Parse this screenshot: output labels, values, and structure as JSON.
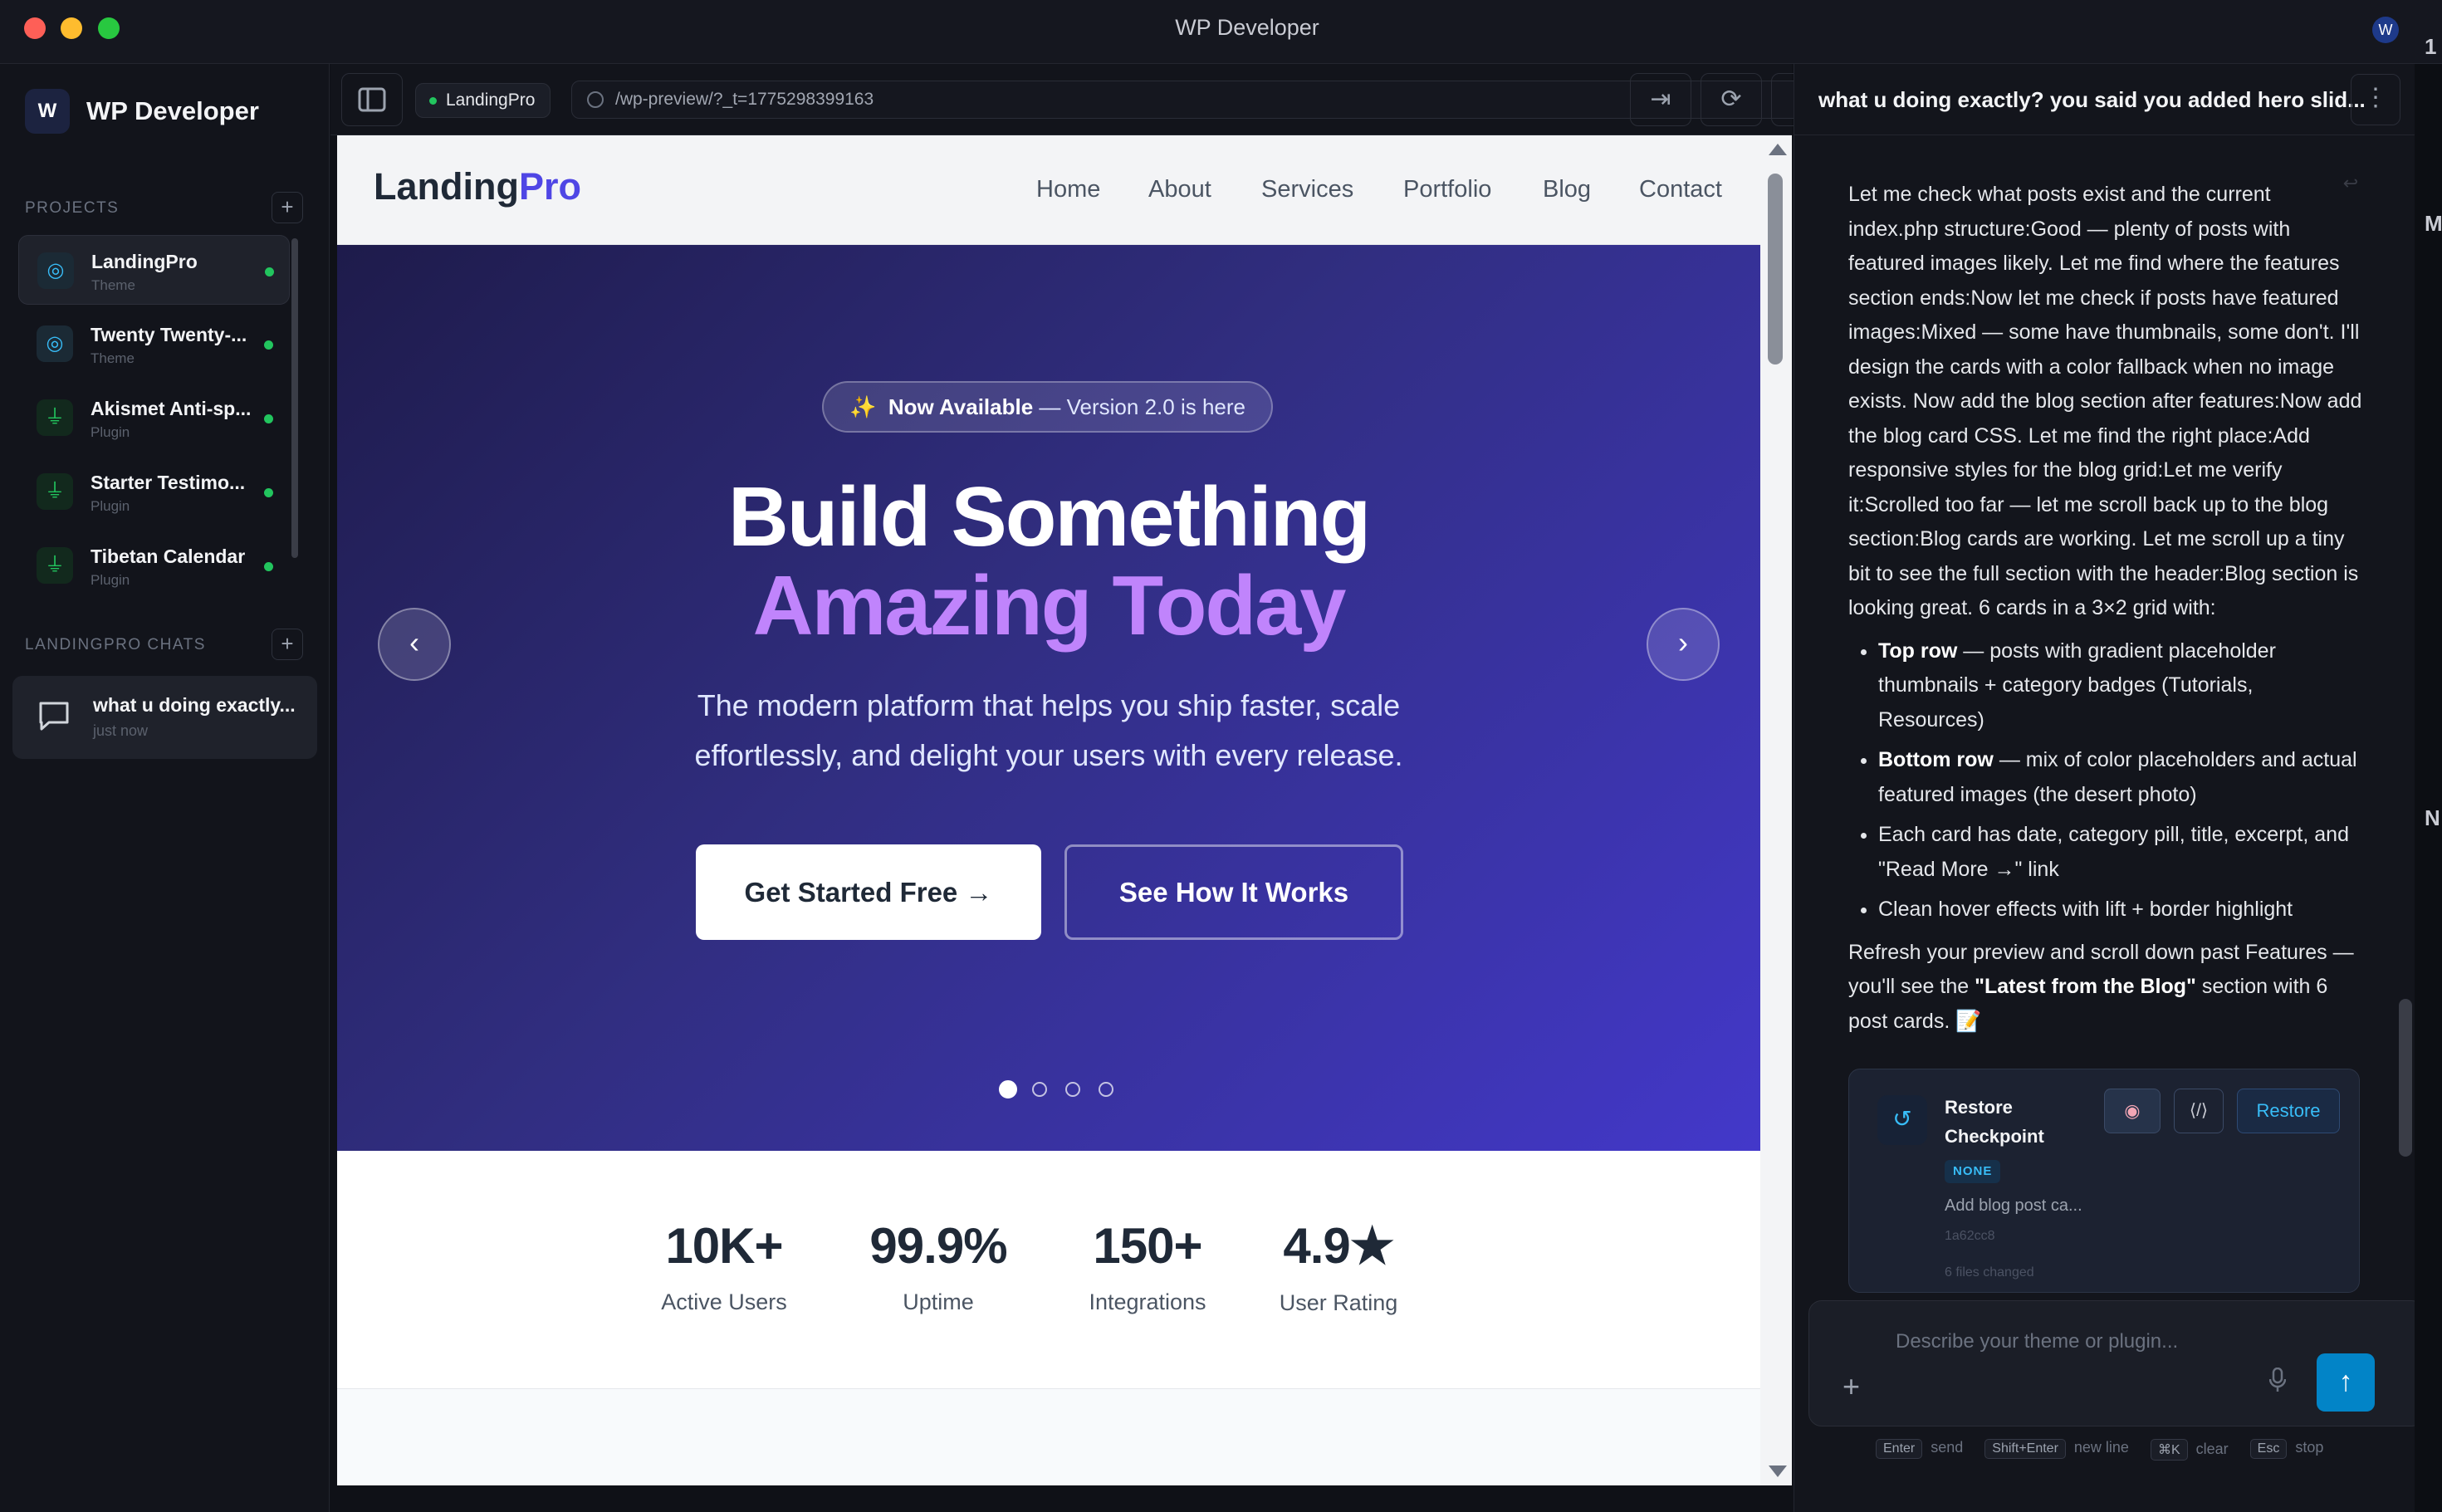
{
  "window": {
    "title": "WP Developer"
  },
  "sidebar": {
    "brand": "WP Developer",
    "brand_logo": "W",
    "projects_heading": "PROJECTS",
    "projects": [
      {
        "name": "LandingPro",
        "type": "Theme",
        "icon": "palette-icon",
        "active": true
      },
      {
        "name": "Twenty Twenty-...",
        "type": "Theme",
        "icon": "palette-icon"
      },
      {
        "name": "Akismet Anti-sp...",
        "type": "Plugin",
        "icon": "plug-icon"
      },
      {
        "name": "Starter Testimo...",
        "type": "Plugin",
        "icon": "plug-icon"
      },
      {
        "name": "Tibetan Calendar",
        "type": "Plugin",
        "icon": "plug-icon"
      }
    ],
    "chats_heading": "LANDINGPRO CHATS",
    "chat": {
      "title": "what u doing exactly...",
      "time": "just now"
    }
  },
  "toolbar": {
    "project_chip": "LandingPro",
    "url": "/wp-preview/?_t=1775298399163"
  },
  "site": {
    "logo_main": "Landing",
    "logo_accent": "Pro",
    "nav": [
      "Home",
      "About",
      "Services",
      "Portfolio",
      "Blog",
      "Contact"
    ],
    "badge_emoji": "✨",
    "badge_strong": "Now Available",
    "badge_rest": " — Version 2.0 is here",
    "hero_line1": "Build Something",
    "hero_line2": "Amazing Today",
    "hero_sub1": "The modern platform that helps you ship faster, scale",
    "hero_sub2": "effortlessly, and delight your users with every release.",
    "cta_primary": "Get Started Free →",
    "cta_secondary": "See How It Works",
    "slide_active": 1,
    "slide_count": 4,
    "slide_progress": 0.33,
    "stats": [
      {
        "value": "10K+",
        "label": "Active Users"
      },
      {
        "value": "99.9%",
        "label": "Uptime"
      },
      {
        "value": "150+",
        "label": "Integrations"
      },
      {
        "value": "4.9★",
        "label": "User Rating"
      }
    ]
  },
  "chat": {
    "title": "what u doing exactly? you said you added hero slid...",
    "message_intro": "Let me check what posts exist and the current index.php structure:Good — plenty of posts with featured images likely. Let me find where the features section ends:Now let me check if posts have featured images:Mixed — some have thumbnails, some don't. I'll design the cards with a color fallback when no image exists. Now add the blog section after features:Now add the blog card CSS. Let me find the right place:Add responsive styles for the blog grid:Let me verify it:Scrolled too far — let me scroll back up to the blog section:Blog cards are working. Let me scroll up a tiny bit to see the full section with the header:Blog section is looking great. 6 cards in a 3×2 grid with:",
    "bullets": [
      {
        "strong": "Top row",
        "text": " — posts with gradient placeholder thumbnails + category badges (Tutorials, Resources)"
      },
      {
        "strong": "Bottom row",
        "text": " — mix of color placeholders and actual featured images (the desert photo)"
      },
      {
        "strong": "",
        "text": "Each card has date, category pill, title, excerpt, and \"Read More →\" link"
      },
      {
        "strong": "",
        "text": "Clean hover effects with lift + border highlight"
      }
    ],
    "closing_pre": "Refresh your preview and scroll down past Features — you'll see the ",
    "closing_strong": "\"Latest from the Blog\"",
    "closing_post": " section with 6 post cards. 📝",
    "checkpoint": {
      "title": "Restore Checkpoint",
      "restore_label": "Restore",
      "code_label": "⟨/⟩",
      "tag": "NONE",
      "desc": "Add blog post ca...",
      "hash": "1a62cc8",
      "files": "6 files changed"
    },
    "input_placeholder": "Describe your theme or plugin...",
    "hints": [
      {
        "key": "Enter",
        "label": "send"
      },
      {
        "key": "Shift+Enter",
        "label": "new line"
      },
      {
        "key": "⌘K",
        "label": "clear"
      },
      {
        "key": "Esc",
        "label": "stop"
      }
    ]
  },
  "right_edge": {
    "text1": "1",
    "text2": "M",
    "text3": "N"
  }
}
